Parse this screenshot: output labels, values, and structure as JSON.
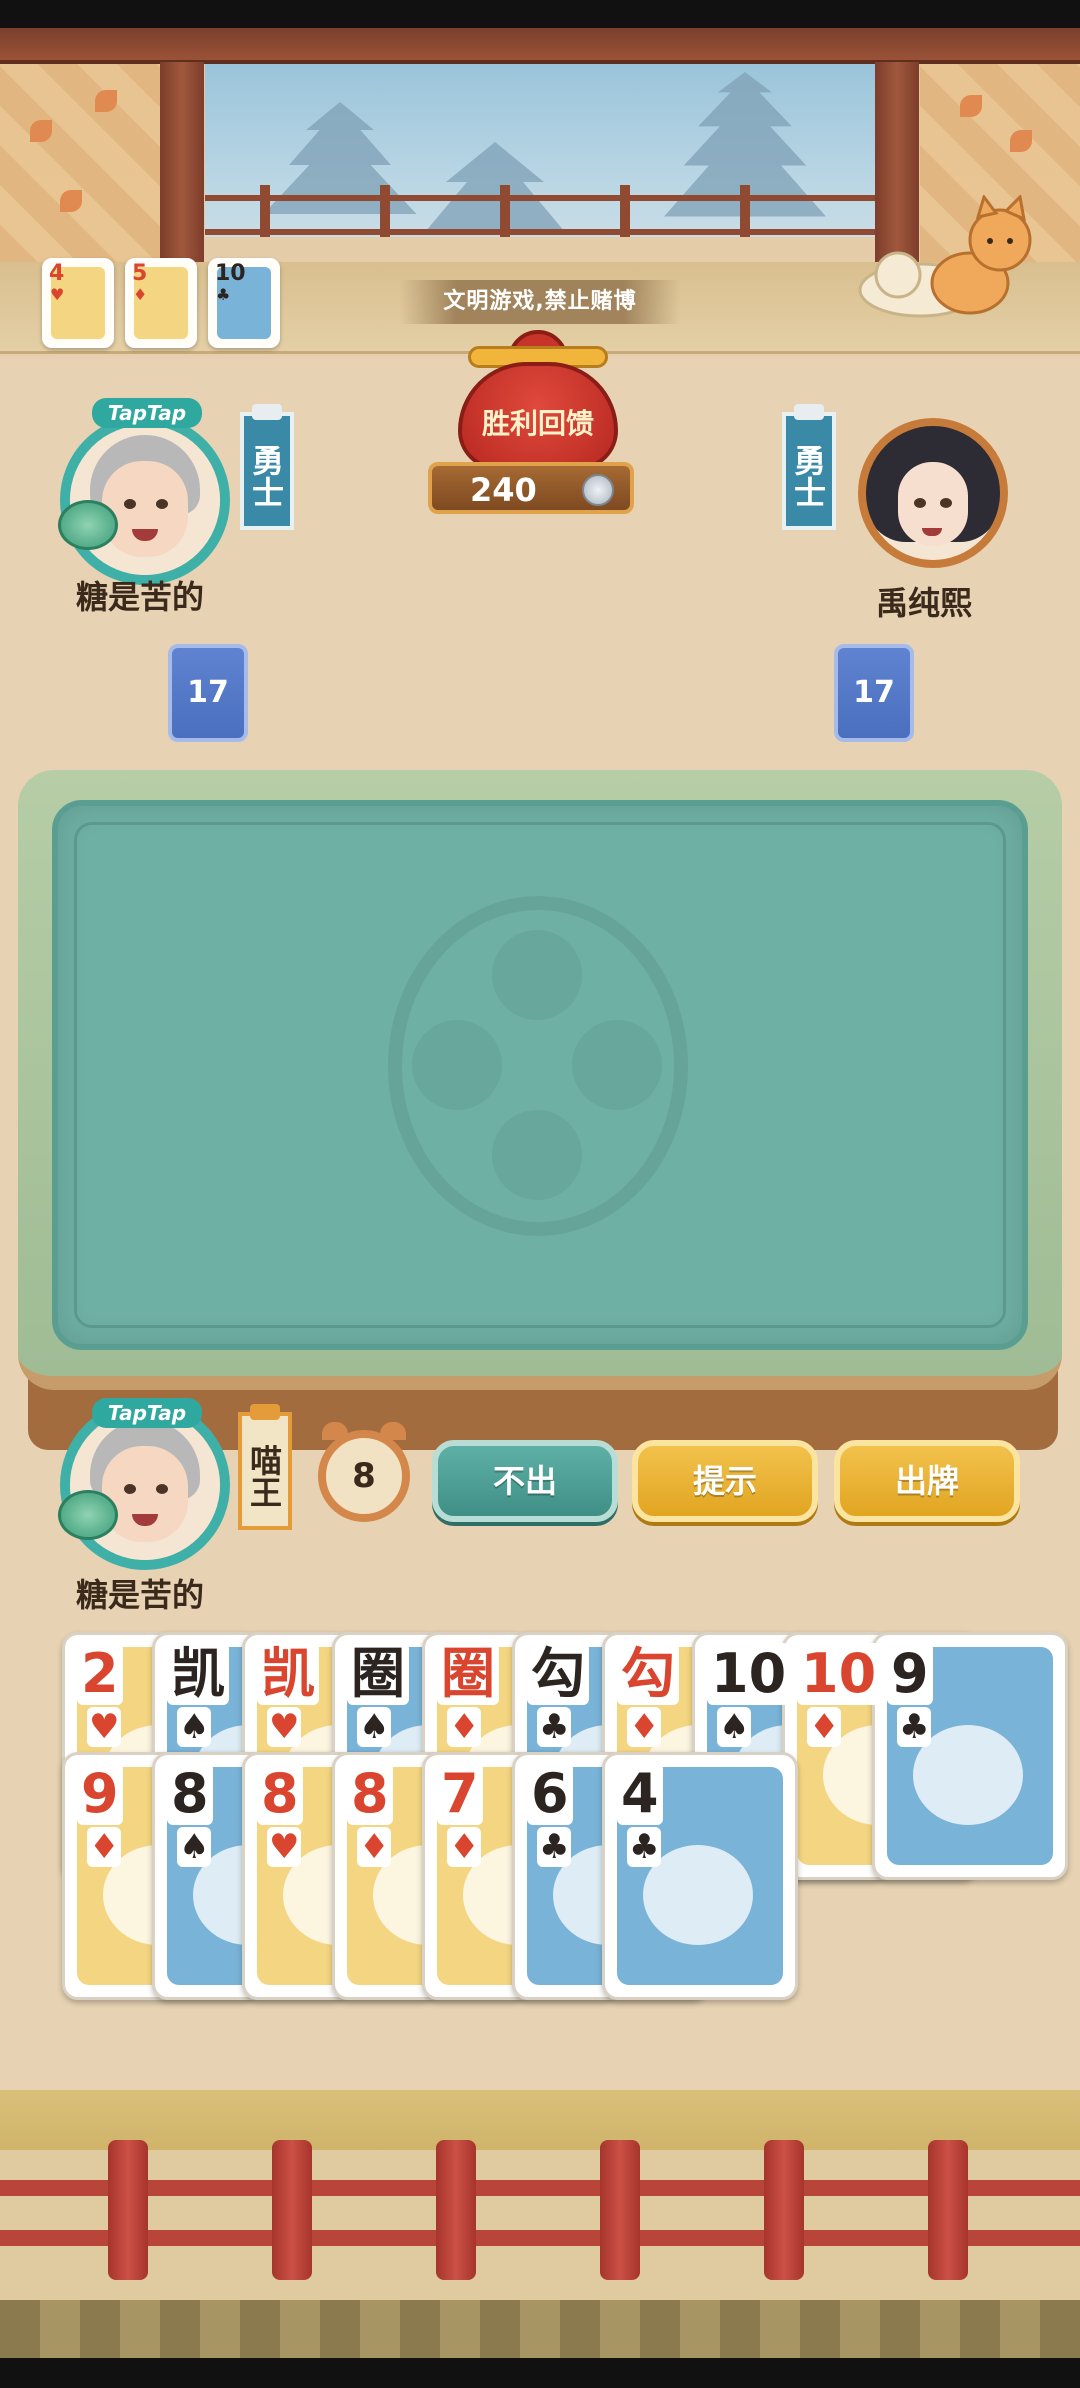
{
  "notice": "文明游戏,禁止赌博",
  "reward": {
    "label": "胜利回馈",
    "amount": "240"
  },
  "mini_cards": [
    {
      "rank": "4",
      "suit": "♥",
      "color": "red",
      "art": "yellow"
    },
    {
      "rank": "5",
      "suit": "♦",
      "color": "red",
      "art": "yellow"
    },
    {
      "rank": "10",
      "suit": "♣",
      "color": "black",
      "art": "blue"
    }
  ],
  "players": {
    "left": {
      "name": "糖是苦的",
      "rank": "勇士",
      "cards_left": "17",
      "badge": "TapTap"
    },
    "right": {
      "name": "禹纯熙",
      "rank": "勇士",
      "cards_left": "17"
    },
    "self": {
      "name": "糖是苦的",
      "rank": "喵王",
      "badge": "TapTap"
    }
  },
  "timer": "8",
  "buttons": {
    "pass": "不出",
    "hint": "提示",
    "play": "出牌"
  },
  "hand_top": [
    {
      "rank": "2",
      "suit": "♥",
      "color": "red",
      "art": "yellow"
    },
    {
      "rank": "凯",
      "suit": "♠",
      "color": "black",
      "art": "blue"
    },
    {
      "rank": "凯",
      "suit": "♥",
      "color": "red",
      "art": "yellow"
    },
    {
      "rank": "圈",
      "suit": "♠",
      "color": "black",
      "art": "blue"
    },
    {
      "rank": "圈",
      "suit": "♦",
      "color": "red",
      "art": "yellow"
    },
    {
      "rank": "勾",
      "suit": "♣",
      "color": "black",
      "art": "blue"
    },
    {
      "rank": "勾",
      "suit": "♦",
      "color": "red",
      "art": "yellow"
    },
    {
      "rank": "10",
      "suit": "♠",
      "color": "black",
      "art": "blue"
    },
    {
      "rank": "10",
      "suit": "♦",
      "color": "red",
      "art": "yellow"
    },
    {
      "rank": "9",
      "suit": "♣",
      "color": "black",
      "art": "blue"
    }
  ],
  "hand_bottom": [
    {
      "rank": "9",
      "suit": "♦",
      "color": "red",
      "art": "yellow"
    },
    {
      "rank": "8",
      "suit": "♠",
      "color": "black",
      "art": "blue"
    },
    {
      "rank": "8",
      "suit": "♥",
      "color": "red",
      "art": "yellow"
    },
    {
      "rank": "8",
      "suit": "♦",
      "color": "red",
      "art": "yellow"
    },
    {
      "rank": "7",
      "suit": "♦",
      "color": "red",
      "art": "yellow"
    },
    {
      "rank": "6",
      "suit": "♣",
      "color": "black",
      "art": "blue"
    },
    {
      "rank": "4",
      "suit": "♣",
      "color": "black",
      "art": "blue"
    }
  ],
  "colors": {
    "felt": "#6fb0a4",
    "accent_teal": "#3f8f86",
    "accent_gold": "#e1a521"
  }
}
